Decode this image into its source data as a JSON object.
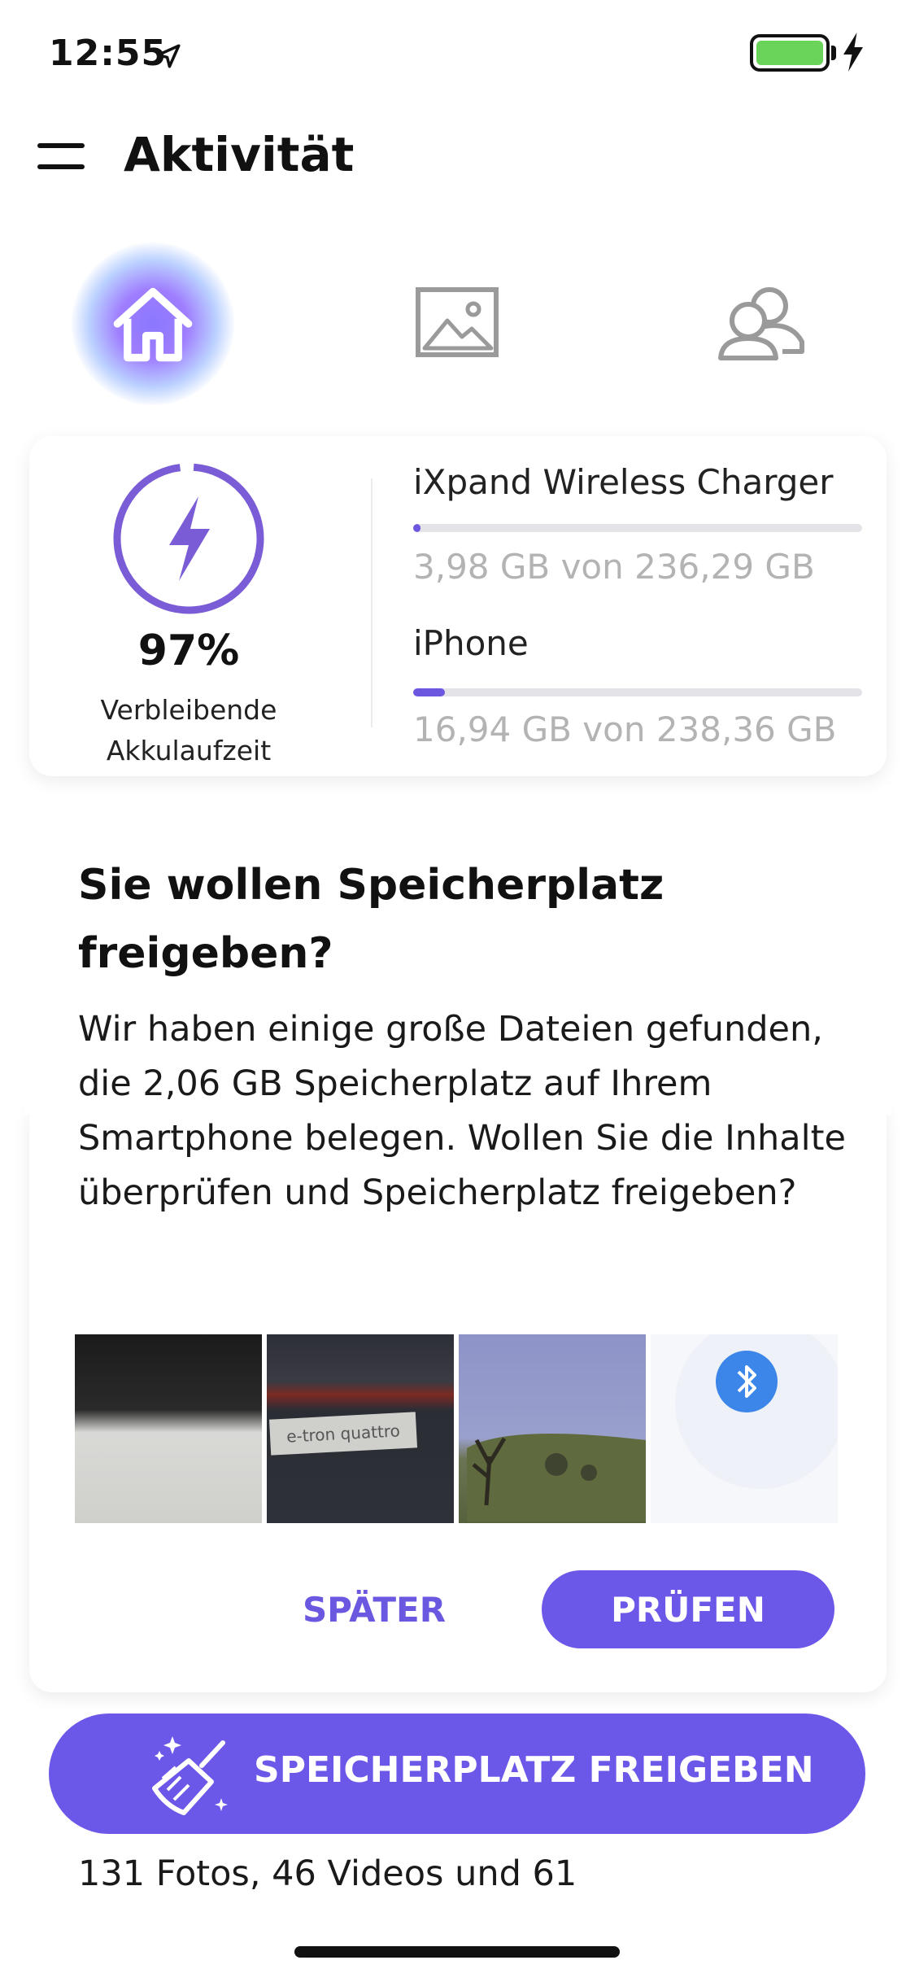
{
  "status_bar": {
    "time": "12:55",
    "battery_level": 1.0
  },
  "header": {
    "title": "Aktivität"
  },
  "tabs": [
    {
      "name": "home",
      "icon": "home-icon",
      "active": true
    },
    {
      "name": "gallery",
      "icon": "image-icon",
      "active": false
    },
    {
      "name": "contacts",
      "icon": "people-icon",
      "active": false
    }
  ],
  "battery": {
    "percent": "97%",
    "label_line1": "Verbleibende",
    "label_line2": "Akkulaufzeit"
  },
  "devices": [
    {
      "name": "iXpand Wireless Charger",
      "usage": "3,98 GB von 236,29 GB",
      "fraction": 0.0168
    },
    {
      "name": "iPhone",
      "usage": "16,94 GB von 238,36 GB",
      "fraction": 0.0711
    }
  ],
  "cleanup_card": {
    "title": "Sie wollen Speicherplatz freigeben?",
    "body": "Wir haben einige große Dateien gefunden, die 2,06 GB Speicherplatz auf Ihrem Smartphone belegen. Wollen Sie die Inhalte überprüfen und Speicherplatz freigeben?",
    "thumb_plate_text": "e-tron quattro",
    "later_label": "SPÄTER",
    "check_label": "PRÜFEN"
  },
  "cta": {
    "label": "SPEICHERPLATZ FREIGEBEN"
  },
  "footer": {
    "summary": "131 Fotos, 46 Videos und 61"
  },
  "colors": {
    "accent": "#6c58e8",
    "battery_green": "#6ad35a",
    "muted_text": "#b3b3b3"
  }
}
